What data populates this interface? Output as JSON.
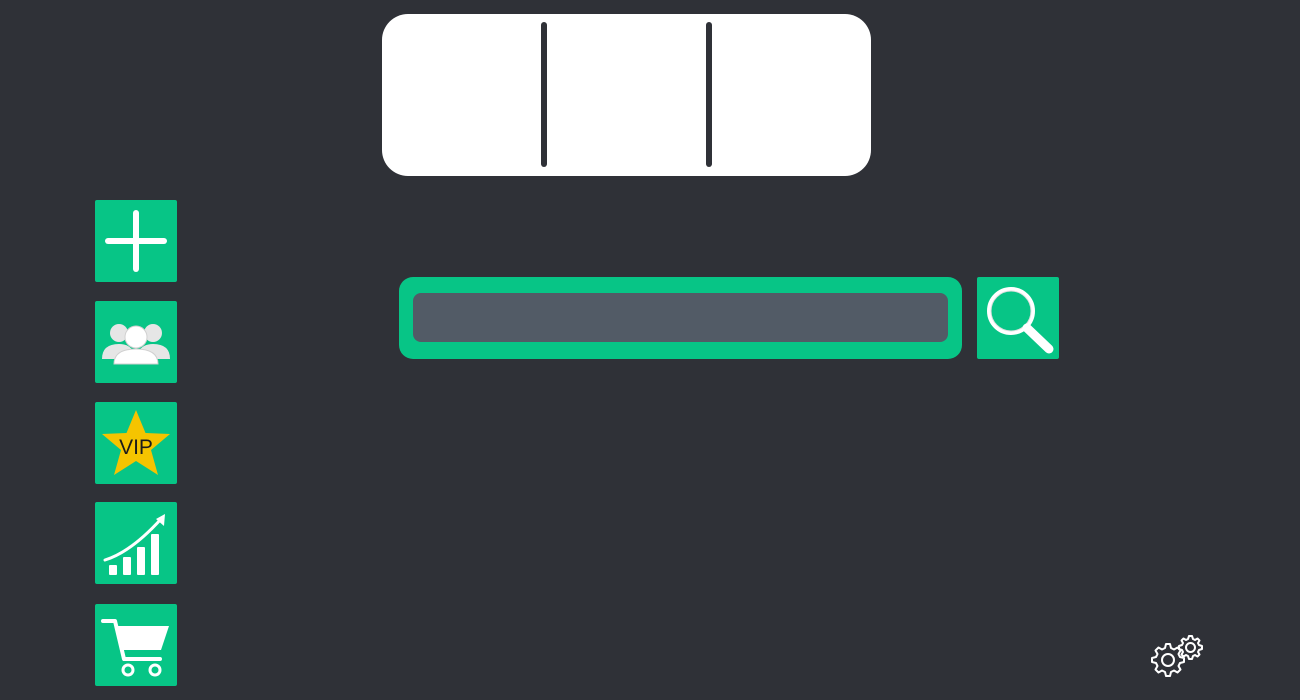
{
  "top_panel": {
    "segments": 3
  },
  "sidebar": {
    "items": [
      {
        "name": "add",
        "icon": "plus-icon"
      },
      {
        "name": "users",
        "icon": "users-group-icon"
      },
      {
        "name": "vip",
        "icon": "vip-star-icon",
        "badge_text": "VIP"
      },
      {
        "name": "stats",
        "icon": "growth-chart-icon"
      },
      {
        "name": "cart",
        "icon": "shopping-cart-icon"
      }
    ]
  },
  "search": {
    "value": "",
    "placeholder": "",
    "icon": "search-icon"
  },
  "settings": {
    "icon": "gears-icon"
  },
  "colors": {
    "background": "#2f3137",
    "accent": "#07c586",
    "input": "#525b66",
    "panel": "#ffffff",
    "star": "#f5c400"
  }
}
